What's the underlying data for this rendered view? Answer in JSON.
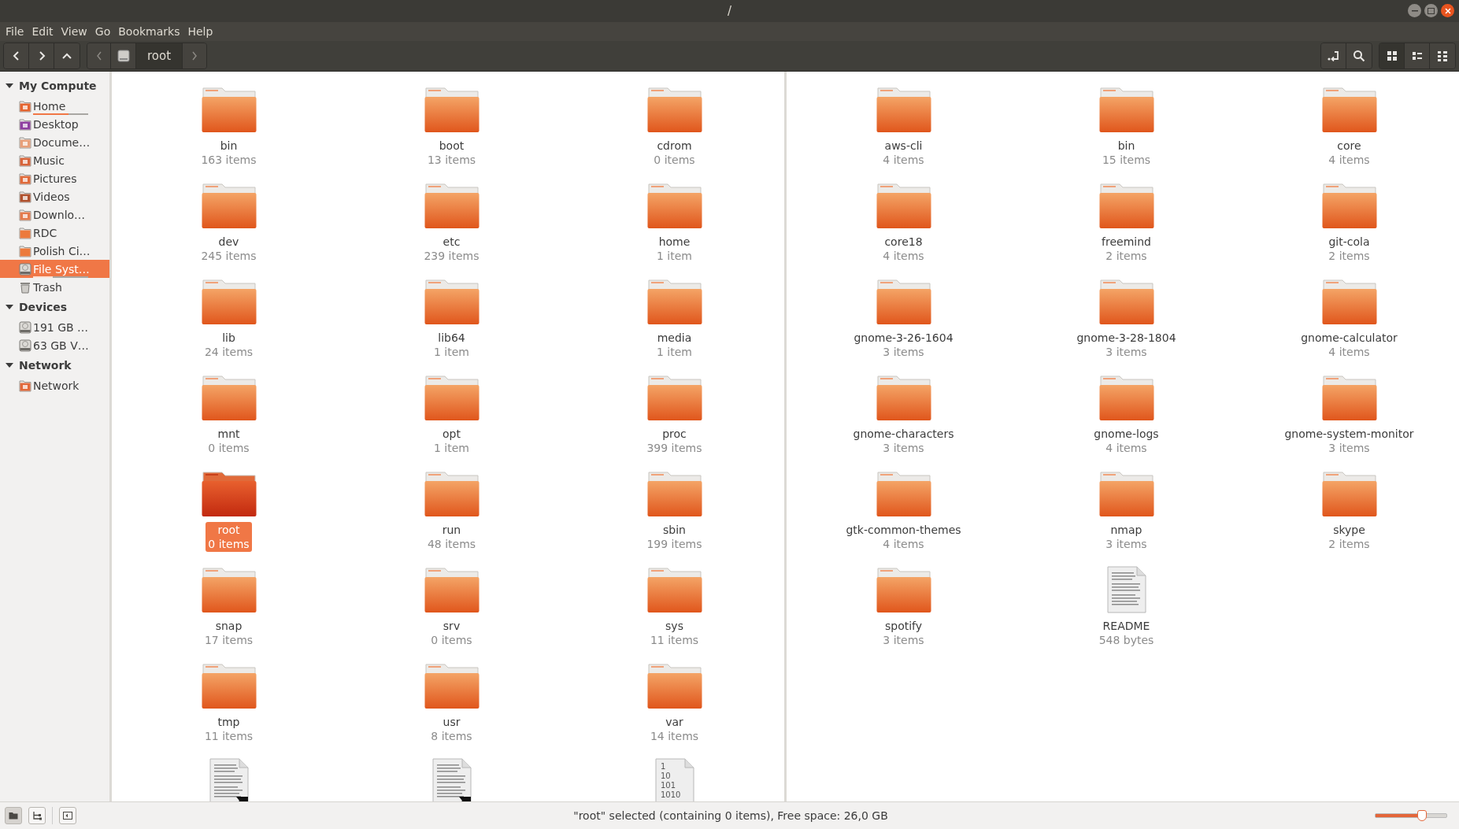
{
  "window": {
    "title": "/"
  },
  "menu": [
    "File",
    "Edit",
    "View",
    "Go",
    "Bookmarks",
    "Help"
  ],
  "path_bar": {
    "segments": [
      {
        "kind": "drive",
        "selected": false
      },
      {
        "kind": "text",
        "label": "root",
        "selected": true
      }
    ]
  },
  "view_modes": [
    {
      "kind": "icons",
      "selected": true
    },
    {
      "kind": "compact",
      "selected": false
    },
    {
      "kind": "list",
      "selected": false
    }
  ],
  "sidebar": {
    "sections": [
      {
        "title": "My Compute",
        "expanded": true,
        "items": [
          {
            "label": "Home",
            "kind": "home",
            "selected": false,
            "usage": {
              "level": 0.64
            }
          },
          {
            "label": "Desktop",
            "kind": "desktop",
            "selected": false
          },
          {
            "label": "Docume…",
            "kind": "documents",
            "selected": false
          },
          {
            "label": "Music",
            "kind": "music",
            "selected": false
          },
          {
            "label": "Pictures",
            "kind": "pictures",
            "selected": false
          },
          {
            "label": "Videos",
            "kind": "videos",
            "selected": false
          },
          {
            "label": "Downlo…",
            "kind": "downloads",
            "selected": false
          },
          {
            "label": "RDC",
            "kind": "folder",
            "selected": false
          },
          {
            "label": "Polish Ci…",
            "kind": "folder",
            "selected": false
          },
          {
            "label": "File Syst…",
            "kind": "drive",
            "selected": true,
            "usage": {
              "level": 0.35
            }
          },
          {
            "label": "Trash",
            "kind": "trash",
            "selected": false
          }
        ]
      },
      {
        "title": "Devices",
        "expanded": true,
        "items": [
          {
            "label": "191 GB …",
            "kind": "drive",
            "selected": false
          },
          {
            "label": "63 GB V…",
            "kind": "drive",
            "selected": false
          }
        ]
      },
      {
        "title": "Network",
        "expanded": true,
        "items": [
          {
            "label": "Network",
            "kind": "network",
            "selected": false
          }
        ]
      }
    ]
  },
  "panes": [
    {
      "items": [
        {
          "kind": "folder",
          "name": "bin",
          "info": "163 items",
          "selected": false
        },
        {
          "kind": "folder",
          "name": "boot",
          "info": "13 items",
          "selected": false
        },
        {
          "kind": "folder",
          "name": "cdrom",
          "info": "0 items",
          "selected": false
        },
        {
          "kind": "folder",
          "name": "dev",
          "info": "245 items",
          "selected": false
        },
        {
          "kind": "folder",
          "name": "etc",
          "info": "239 items",
          "selected": false
        },
        {
          "kind": "folder",
          "name": "home",
          "info": "1 item",
          "selected": false
        },
        {
          "kind": "folder",
          "name": "lib",
          "info": "24 items",
          "selected": false
        },
        {
          "kind": "folder",
          "name": "lib64",
          "info": "1 item",
          "selected": false
        },
        {
          "kind": "folder",
          "name": "media",
          "info": "1 item",
          "selected": false
        },
        {
          "kind": "folder",
          "name": "mnt",
          "info": "0 items",
          "selected": false
        },
        {
          "kind": "folder",
          "name": "opt",
          "info": "1 item",
          "selected": false
        },
        {
          "kind": "folder",
          "name": "proc",
          "info": "399 items",
          "selected": false
        },
        {
          "kind": "folder",
          "name": "root",
          "info": "0 items",
          "selected": true
        },
        {
          "kind": "folder",
          "name": "run",
          "info": "48 items",
          "selected": false
        },
        {
          "kind": "folder",
          "name": "sbin",
          "info": "199 items",
          "selected": false
        },
        {
          "kind": "folder",
          "name": "snap",
          "info": "17 items",
          "selected": false
        },
        {
          "kind": "folder",
          "name": "srv",
          "info": "0 items",
          "selected": false
        },
        {
          "kind": "folder",
          "name": "sys",
          "info": "11 items",
          "selected": false
        },
        {
          "kind": "folder",
          "name": "tmp",
          "info": "11 items",
          "selected": false
        },
        {
          "kind": "folder",
          "name": "usr",
          "info": "8 items",
          "selected": false
        },
        {
          "kind": "folder",
          "name": "var",
          "info": "14 items",
          "selected": false
        },
        {
          "kind": "text-file",
          "symlink": true,
          "selected": false
        },
        {
          "kind": "text-file",
          "symlink": true,
          "selected": false
        },
        {
          "kind": "binary-file",
          "symlink": false,
          "icon_text": [
            "1",
            "10",
            "101",
            "1010"
          ],
          "selected": false
        }
      ]
    },
    {
      "items": [
        {
          "kind": "folder",
          "name": "aws-cli",
          "info": "4 items",
          "selected": false
        },
        {
          "kind": "folder",
          "name": "bin",
          "info": "15 items",
          "selected": false
        },
        {
          "kind": "folder",
          "name": "core",
          "info": "4 items",
          "selected": false
        },
        {
          "kind": "folder",
          "name": "core18",
          "info": "4 items",
          "selected": false
        },
        {
          "kind": "folder",
          "name": "freemind",
          "info": "2 items",
          "selected": false
        },
        {
          "kind": "folder",
          "name": "git-cola",
          "info": "2 items",
          "selected": false
        },
        {
          "kind": "folder",
          "name": "gnome-3-26-1604",
          "info": "3 items",
          "selected": false
        },
        {
          "kind": "folder",
          "name": "gnome-3-28-1804",
          "info": "3 items",
          "selected": false
        },
        {
          "kind": "folder",
          "name": "gnome-calculator",
          "info": "4 items",
          "selected": false
        },
        {
          "kind": "folder",
          "name": "gnome-characters",
          "info": "3 items",
          "selected": false
        },
        {
          "kind": "folder",
          "name": "gnome-logs",
          "info": "4 items",
          "selected": false
        },
        {
          "kind": "folder",
          "name": "gnome-system-monitor",
          "info": "3 items",
          "selected": false
        },
        {
          "kind": "folder",
          "name": "gtk-common-themes",
          "info": "4 items",
          "selected": false
        },
        {
          "kind": "folder",
          "name": "nmap",
          "info": "3 items",
          "selected": false
        },
        {
          "kind": "folder",
          "name": "skype",
          "info": "2 items",
          "selected": false
        },
        {
          "kind": "folder",
          "name": "spotify",
          "info": "3 items",
          "selected": false
        },
        {
          "kind": "text-file",
          "name": "README",
          "info": "548 bytes",
          "symlink": false,
          "selected": false
        }
      ]
    }
  ],
  "status_bar": {
    "sidebar_modes": [
      {
        "kind": "places",
        "selected": true
      },
      {
        "kind": "tree",
        "selected": false
      }
    ],
    "text": "\"root\" selected (containing 0 items), Free space: 26,0 GB",
    "zoom": {
      "level": 0.66
    }
  }
}
